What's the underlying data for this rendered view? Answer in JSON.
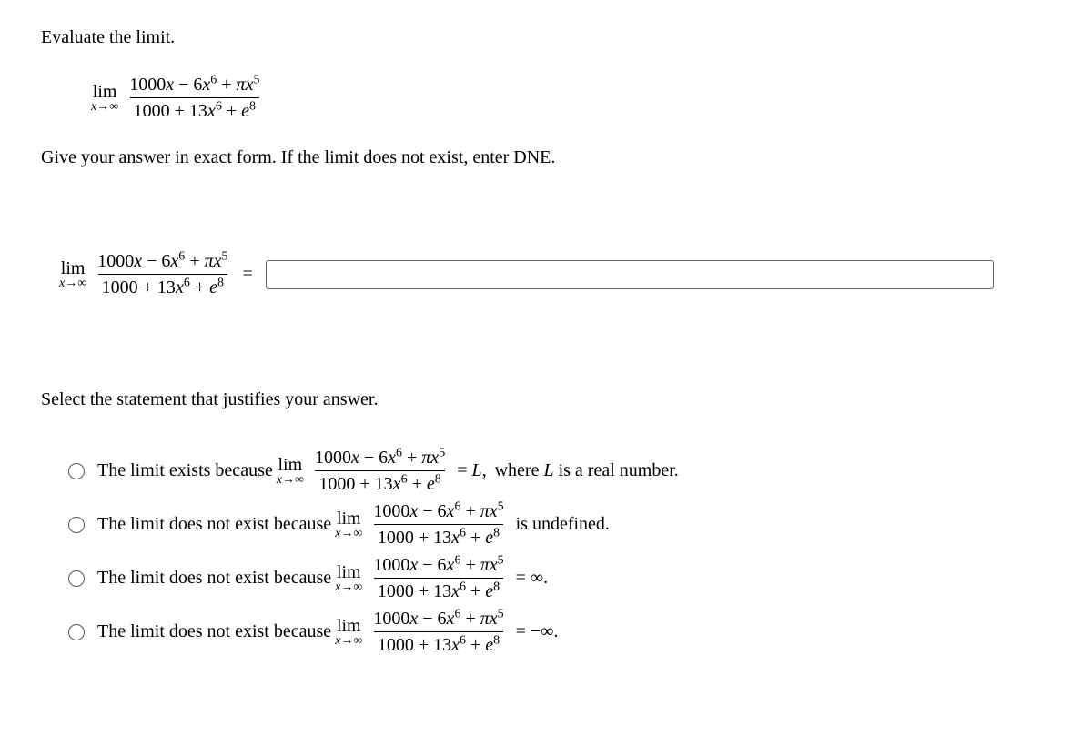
{
  "prompt": "Evaluate the limit.",
  "limit": {
    "lim_label": "lim",
    "lim_sub": "x→∞",
    "numerator": "1000x − 6x⁶ + πx⁵",
    "denominator": "1000 + 13x⁶ + e⁸"
  },
  "instruction": "Give your answer in exact form. If the limit does not exist, enter DNE.",
  "equals": "=",
  "answer_placeholder": "",
  "select_prompt": "Select the statement that justifies your answer.",
  "options": {
    "opt1": {
      "pre": "The limit exists because",
      "post_eq": "= L, ",
      "post": "where L is a real number."
    },
    "opt2": {
      "pre": "The limit does not exist because",
      "post": "is undefined."
    },
    "opt3": {
      "pre": "The limit does not exist because",
      "post": "= ∞."
    },
    "opt4": {
      "pre": "The limit does not exist because",
      "post": "= −∞."
    }
  },
  "chart_data": {
    "type": "table",
    "description": "Math limit problem with radio-button justification options",
    "expression": "lim_{x→∞} (1000x − 6x^6 + πx^5) / (1000 + 13x^6 + e^8)",
    "answer_field": "",
    "choices": [
      "The limit exists because lim (expr) = L, where L is a real number.",
      "The limit does not exist because lim (expr) is undefined.",
      "The limit does not exist because lim (expr) = ∞.",
      "The limit does not exist because lim (expr) = −∞."
    ]
  }
}
